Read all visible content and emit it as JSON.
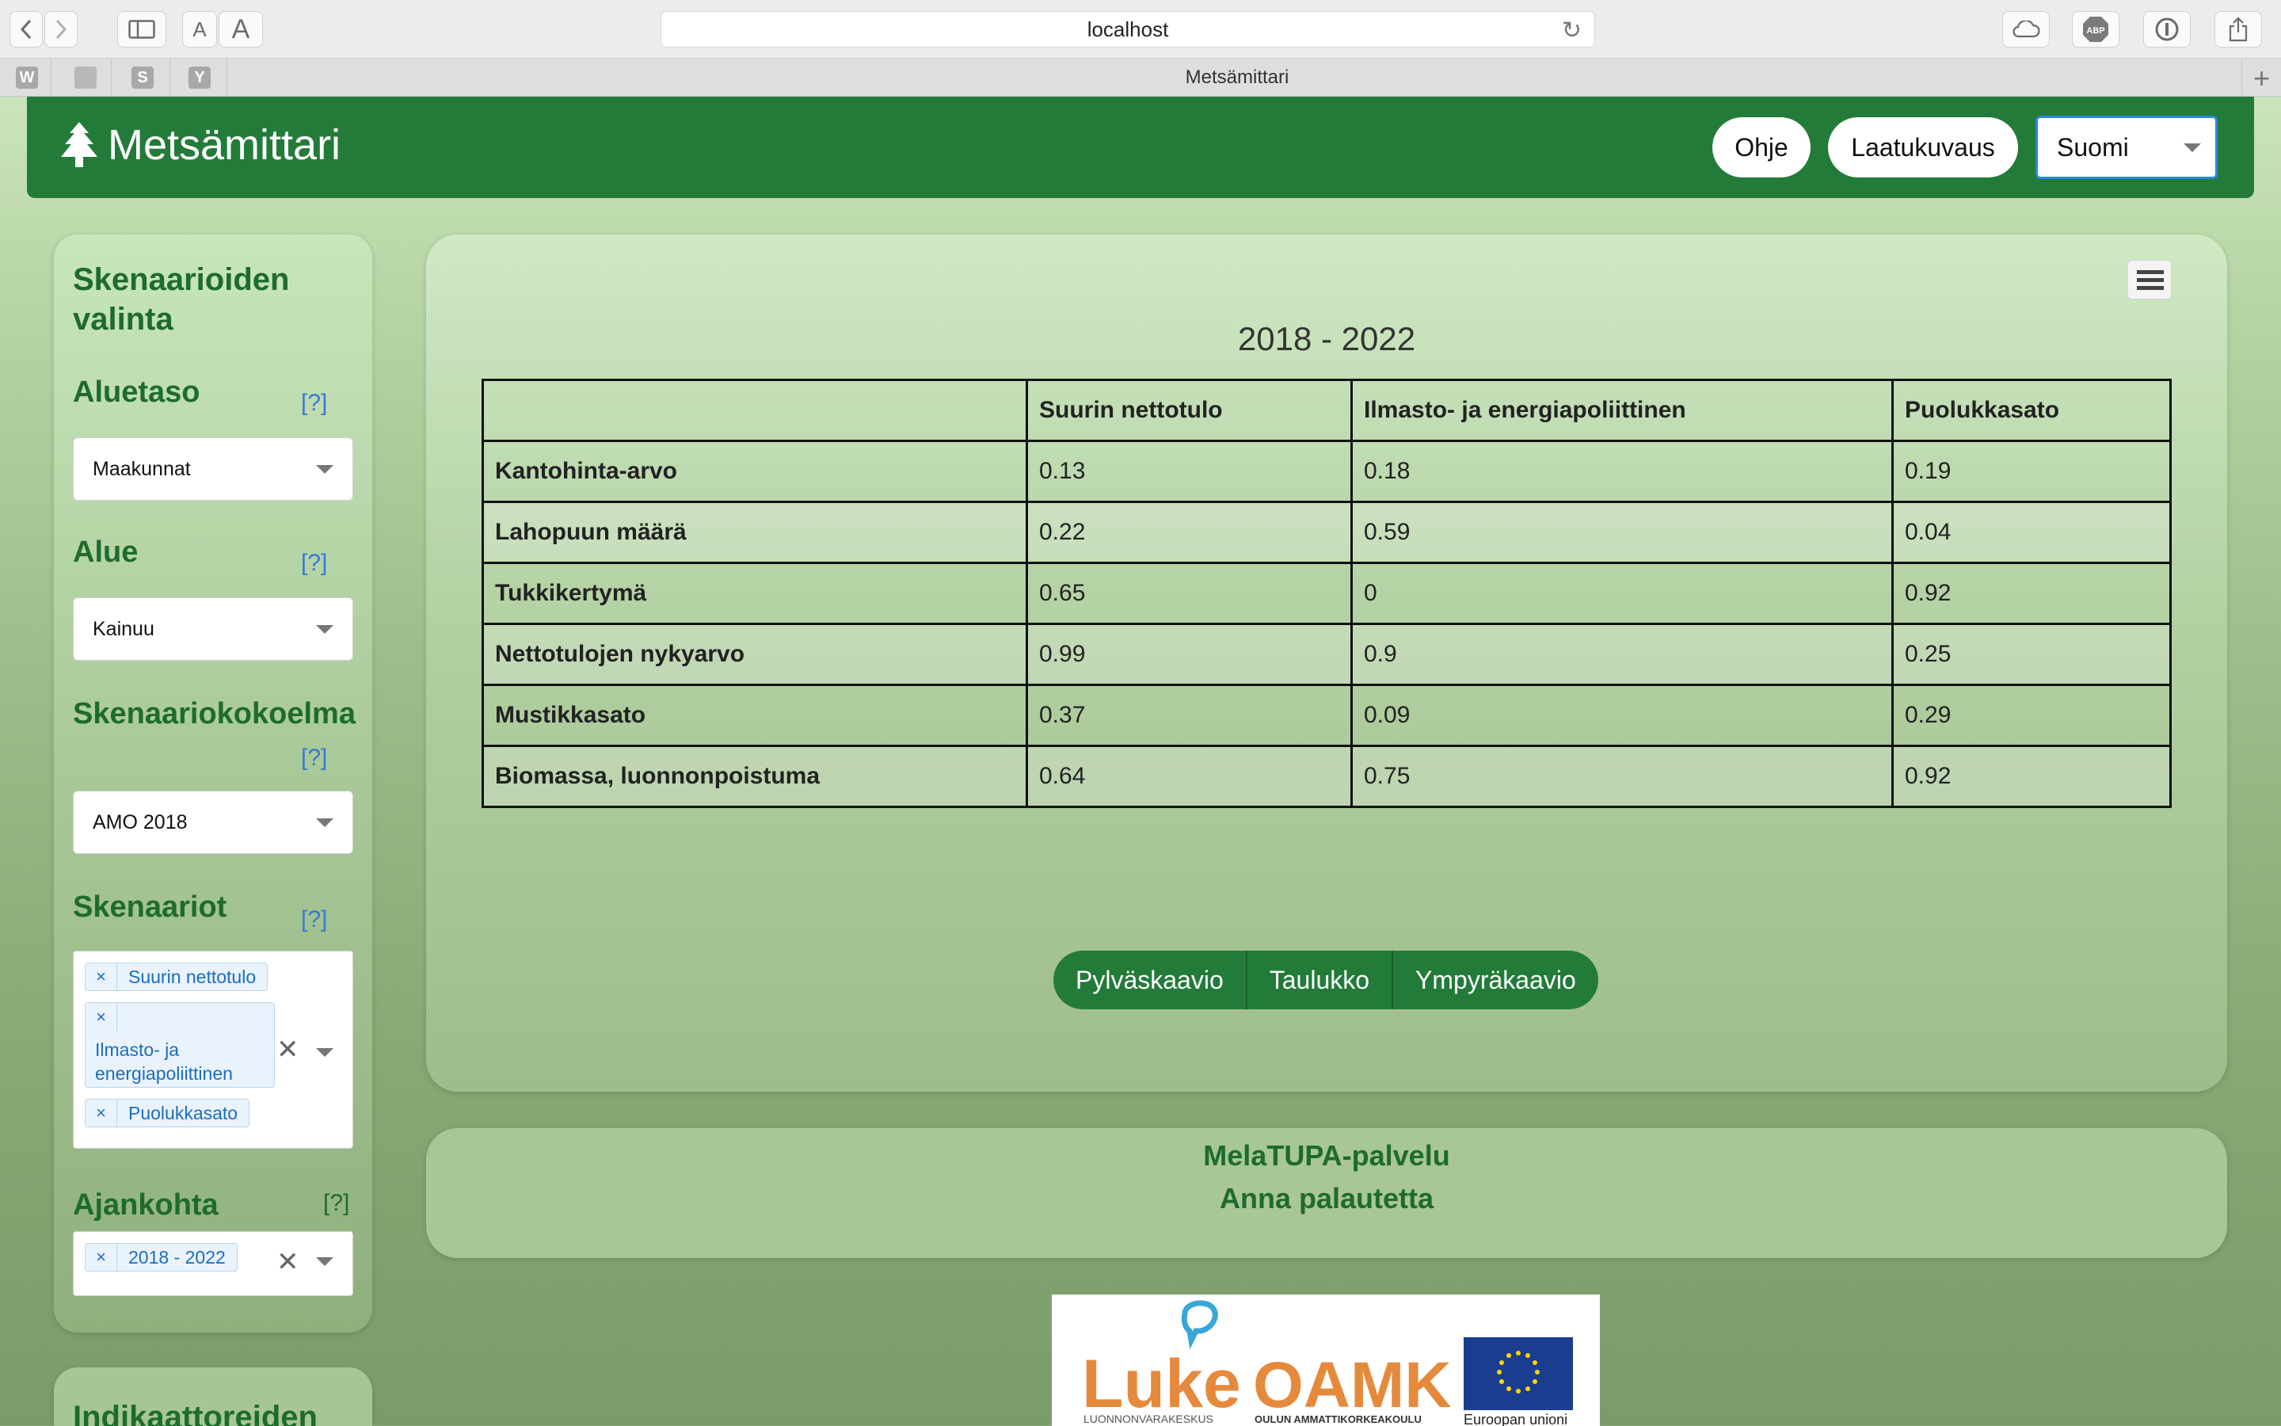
{
  "browser": {
    "url": "localhost",
    "tab_title": "Metsämittari",
    "favorites": [
      "W",
      "",
      "S",
      "Y"
    ],
    "reader_small": "A",
    "reader_large": "A"
  },
  "header": {
    "brand": "Metsämittari",
    "help_button": "Ohje",
    "quality_button": "Laatukuvaus",
    "language": "Suomi"
  },
  "sidebar": {
    "title": "Skenaarioiden valinta",
    "help_marker": "[?]",
    "level_label": "Aluetaso",
    "level_value": "Maakunnat",
    "area_label": "Alue",
    "area_value": "Kainuu",
    "collection_label": "Skenaariokokoelma",
    "collection_value": "AMO 2018",
    "scenarios_label": "Skenaariot",
    "scenarios": [
      "Suurin nettotulo",
      "Ilmasto- ja energiapoliittinen",
      "Puolukkasato"
    ],
    "time_label": "Ajankohta",
    "time_values": [
      "2018 - 2022"
    ],
    "chip_remove": "×",
    "clear": "✕",
    "next_title": "Indikaattoreiden"
  },
  "main": {
    "table_title": "2018 - 2022",
    "columns": [
      "",
      "Suurin nettotulo",
      "Ilmasto- ja energiapoliittinen",
      "Puolukkasato"
    ],
    "rows": [
      {
        "label": "Kantohinta-arvo",
        "values": [
          "0.13",
          "0.18",
          "0.19"
        ]
      },
      {
        "label": "Lahopuun määrä",
        "values": [
          "0.22",
          "0.59",
          "0.04"
        ]
      },
      {
        "label": "Tukkikertymä",
        "values": [
          "0.65",
          "0",
          "0.92"
        ]
      },
      {
        "label": "Nettotulojen nykyarvo",
        "values": [
          "0.99",
          "0.9",
          "0.25"
        ]
      },
      {
        "label": "Mustikkasato",
        "values": [
          "0.37",
          "0.09",
          "0.29"
        ]
      },
      {
        "label": "Biomassa, luonnonpoistuma",
        "values": [
          "0.64",
          "0.75",
          "0.92"
        ]
      }
    ],
    "view_buttons": [
      "Pylväskaavio",
      "Taulukko",
      "Ympyräkaavio"
    ]
  },
  "feedback": {
    "service_link": "MelaTUPA-palvelu",
    "feedback_link": "Anna palautetta"
  },
  "logos": {
    "luke_name": "Luke",
    "luke_sub": "LUONNONVARAKESKUS",
    "oamk_name": "OAMK",
    "oamk_sub": "OULUN AMMATTIKORKEAKOULU",
    "eu_sub": "Euroopan unioni"
  },
  "colors": {
    "brand_green": "#237b3a",
    "label_green": "#1e6b2e",
    "link_blue": "#3a78d4",
    "luke_orange": "#e58a3c",
    "luke_blue": "#3aa6d8",
    "eu_blue": "#1a3d8f"
  }
}
